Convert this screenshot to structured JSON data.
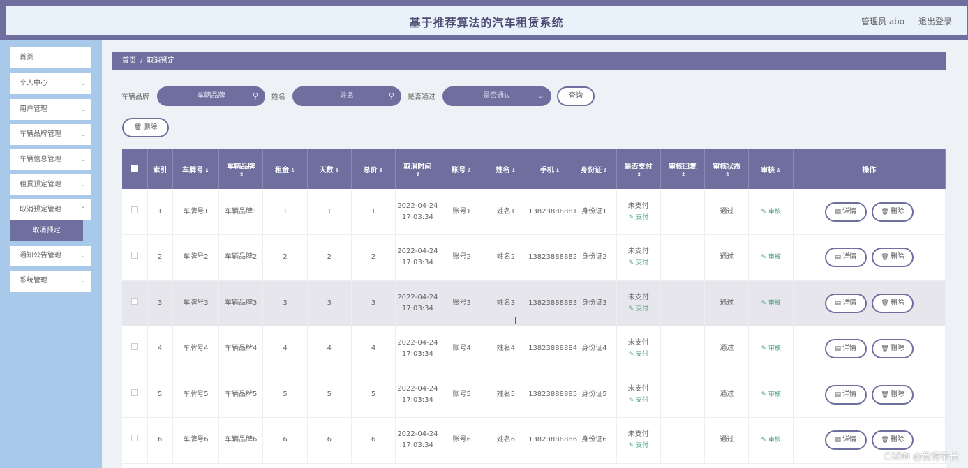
{
  "header": {
    "title": "基于推荐算法的汽车租赁系统",
    "admin": "管理员 abo",
    "logout": "退出登录"
  },
  "sidebar": {
    "items": [
      {
        "label": "首页",
        "has_arrow": false
      },
      {
        "label": "个人中心",
        "has_arrow": true
      },
      {
        "label": "用户管理",
        "has_arrow": true
      },
      {
        "label": "车辆品牌管理",
        "has_arrow": true
      },
      {
        "label": "车辆信息管理",
        "has_arrow": true
      },
      {
        "label": "租赁预定管理",
        "has_arrow": true
      },
      {
        "label": "取消预定管理",
        "has_arrow": true
      },
      {
        "label": "通知公告管理",
        "has_arrow": true
      },
      {
        "label": "系统管理",
        "has_arrow": true
      }
    ],
    "active_sub": "取消预定"
  },
  "breadcrumb": {
    "home": "首页",
    "sep": "/",
    "current": "取消预定"
  },
  "search": {
    "brand_label": "车辆品牌",
    "brand_placeholder": "车辆品牌",
    "name_label": "姓名",
    "name_placeholder": "姓名",
    "passed_label": "是否通过",
    "passed_placeholder": "是否通过",
    "query_button": "查询"
  },
  "toolbar": {
    "delete_label": "删除"
  },
  "table": {
    "columns": [
      "索引",
      "车牌号",
      "车辆品牌",
      "租金",
      "天数",
      "总价",
      "取消时间",
      "账号",
      "姓名",
      "手机",
      "身份证",
      "是否支付",
      "审核回复",
      "审核状态",
      "审核",
      "操作"
    ],
    "pay_link": "支付",
    "audit_link": "审核",
    "detail_btn": "详情",
    "delete_btn": "删除",
    "rows": [
      {
        "index": "1",
        "plate": "车牌号1",
        "brand": "车辆品牌1",
        "rent": "1",
        "days": "1",
        "total": "1",
        "time": "2022-04-24 17:03:34",
        "account": "账号1",
        "name": "姓名1",
        "phone": "13823888881",
        "idcard": "身份证1",
        "paid": "未支付",
        "reply": "",
        "status": "通过"
      },
      {
        "index": "2",
        "plate": "车牌号2",
        "brand": "车辆品牌2",
        "rent": "2",
        "days": "2",
        "total": "2",
        "time": "2022-04-24 17:03:34",
        "account": "账号2",
        "name": "姓名2",
        "phone": "13823888882",
        "idcard": "身份证2",
        "paid": "未支付",
        "reply": "",
        "status": "通过"
      },
      {
        "index": "3",
        "plate": "车牌号3",
        "brand": "车辆品牌3",
        "rent": "3",
        "days": "3",
        "total": "3",
        "time": "2022-04-24 17:03:34",
        "account": "账号3",
        "name": "姓名3",
        "phone": "13823888883",
        "idcard": "身份证3",
        "paid": "未支付",
        "reply": "",
        "status": "通过"
      },
      {
        "index": "4",
        "plate": "车牌号4",
        "brand": "车辆品牌4",
        "rent": "4",
        "days": "4",
        "total": "4",
        "time": "2022-04-24 17:03:34",
        "account": "账号4",
        "name": "姓名4",
        "phone": "13823888884",
        "idcard": "身份证4",
        "paid": "未支付",
        "reply": "",
        "status": "通过"
      },
      {
        "index": "5",
        "plate": "车牌号5",
        "brand": "车辆品牌5",
        "rent": "5",
        "days": "5",
        "total": "5",
        "time": "2022-04-24 17:03:34",
        "account": "账号5",
        "name": "姓名5",
        "phone": "13823888885",
        "idcard": "身份证5",
        "paid": "未支付",
        "reply": "",
        "status": "通过"
      },
      {
        "index": "6",
        "plate": "车牌号6",
        "brand": "车辆品牌6",
        "rent": "6",
        "days": "6",
        "total": "6",
        "time": "2022-04-24 17:03:34",
        "account": "账号6",
        "name": "姓名6",
        "phone": "13823888886",
        "idcard": "身份证6",
        "paid": "未支付",
        "reply": "",
        "status": "通过"
      }
    ]
  },
  "watermark": "CSDN @爱得学长",
  "colors": {
    "primary": "#6f6f9f",
    "sidebar_bg": "#a8c9ea",
    "link_green": "#4aa37a"
  }
}
